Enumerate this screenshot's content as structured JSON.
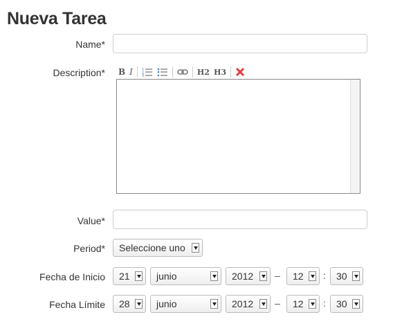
{
  "page": {
    "title": "Nueva Tarea"
  },
  "form": {
    "name": {
      "label": "Name*",
      "value": ""
    },
    "description": {
      "label": "Description*",
      "toolbar": [
        "B",
        "I",
        "ordered-list",
        "unordered-list",
        "link",
        "H2",
        "H3",
        "remove-format"
      ]
    },
    "value": {
      "label": "Value*",
      "value": ""
    },
    "period": {
      "label": "Period*",
      "selected": "Seleccione uno"
    },
    "start": {
      "label": "Fecha de Inicio",
      "day": "21",
      "month": "junio",
      "year": "2012",
      "dash": "–",
      "hour": "12",
      "colon": ":",
      "minute": "30"
    },
    "end": {
      "label": "Fecha Límite",
      "day": "28",
      "month": "junio",
      "year": "2012",
      "dash": "–",
      "hour": "12",
      "colon": ":",
      "minute": "30"
    }
  },
  "colors": {
    "remove_icon": "#e03c3c",
    "ordered_list_icon": "#4a7fc1"
  }
}
